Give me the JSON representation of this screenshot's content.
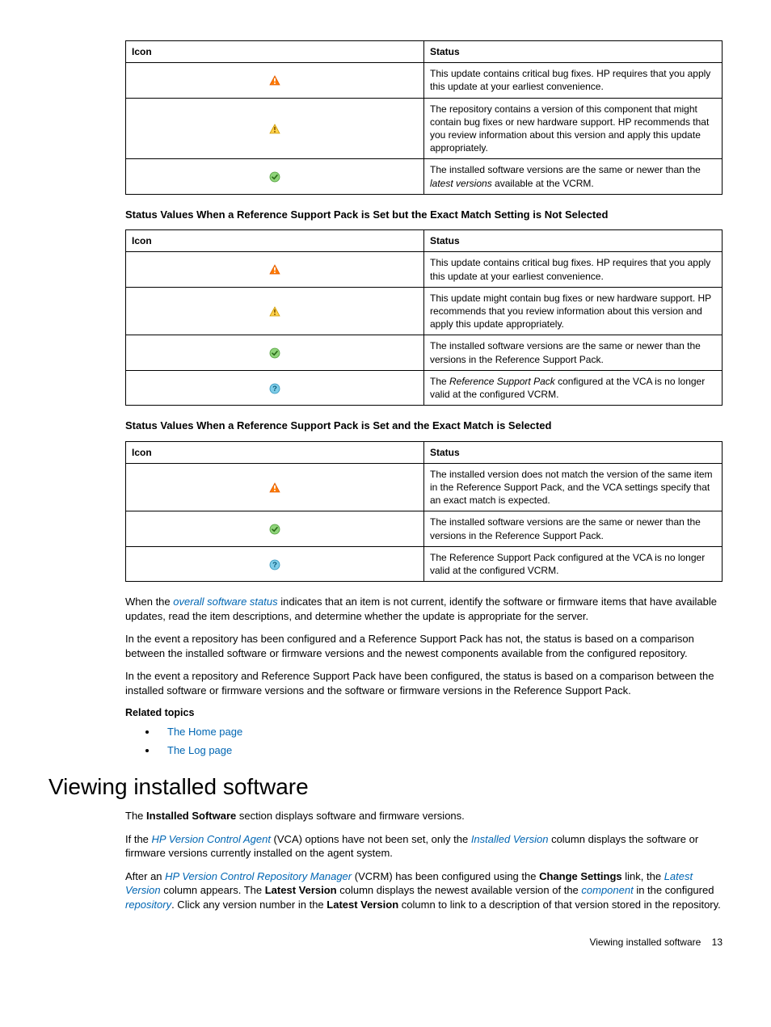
{
  "table1": {
    "headers": [
      "Icon",
      "Status"
    ],
    "rows": [
      {
        "icon": "critical",
        "status_pre": "This update contains critical bug fixes. HP requires that you apply this update at your earliest convenience."
      },
      {
        "icon": "warning",
        "status_pre": "The repository contains a version of this component that might contain bug fixes or new hardware support. HP recommends that you review information about this version and apply this update appropriately."
      },
      {
        "icon": "ok",
        "status_pre": "The installed software versions are the same or newer than the ",
        "status_em": "latest versions",
        "status_post": " available at the VCRM."
      }
    ]
  },
  "heading2": "Status Values When a Reference Support Pack is Set but the Exact Match Setting is Not Selected",
  "table2": {
    "headers": [
      "Icon",
      "Status"
    ],
    "rows": [
      {
        "icon": "critical",
        "status_pre": "This update contains critical bug fixes. HP requires that you apply this update at your earliest convenience."
      },
      {
        "icon": "warning",
        "status_pre": "This update might contain bug fixes or new hardware support. HP recommends that you review information about this version and apply this update appropriately."
      },
      {
        "icon": "ok",
        "status_pre": "The installed software versions are the same or newer than the versions in the Reference Support Pack."
      },
      {
        "icon": "question",
        "status_pre": "The ",
        "status_em": "Reference Support Pack",
        "status_post": " configured at the VCA is no longer valid at the configured VCRM."
      }
    ]
  },
  "heading3": "Status Values When a Reference Support Pack is Set and the Exact Match is Selected",
  "table3": {
    "headers": [
      "Icon",
      "Status"
    ],
    "rows": [
      {
        "icon": "critical",
        "status_pre": "The installed version does not match the version of the same item in the Reference Support Pack, and the VCA settings specify that an exact match is expected."
      },
      {
        "icon": "ok",
        "status_pre": "The installed software versions are the same or newer than the versions in the Reference Support Pack."
      },
      {
        "icon": "question",
        "status_pre": "The Reference Support Pack configured at the VCA is no longer valid at the configured VCRM."
      }
    ]
  },
  "para1": {
    "pre": "When the ",
    "em": "overall software status",
    "post": " indicates that an item is not current, identify the software or firmware items that have available updates, read the item descriptions, and determine whether the update is appropriate for the server."
  },
  "para2": "In the event a repository has been configured and a Reference Support Pack has not, the status is based on a comparison between the installed software or firmware versions and the newest components available from the configured repository.",
  "para3": "In the event a repository and Reference Support Pack have been configured, the status is based on a comparison between the installed software or firmware versions and the software or firmware versions in the Reference Support Pack.",
  "related_label": "Related topics",
  "related_items": [
    "The Home page",
    "The Log page"
  ],
  "h1": "Viewing installed software",
  "vis_para1": {
    "pre": "The ",
    "b1": "Installed Software",
    "post": " section displays software and firmware versions."
  },
  "vis_para2": {
    "pre": "If the ",
    "l1": "HP Version Control Agent",
    "mid": " (VCA) options have not been set, only the ",
    "l2": "Installed Version",
    "post": " column displays the software or firmware versions currently installed on the agent system."
  },
  "vis_para3": {
    "pre": "After an ",
    "l1": "HP Version Control Repository Manager",
    "t1": " (VCRM) has been configured using the ",
    "b1": "Change Settings",
    "t2": " link, the ",
    "l2": "Latest Version",
    "t3": " column appears. The ",
    "b2": "Latest Version",
    "t4": " column displays the newest available version of the ",
    "l3": "component",
    "t5": " in the configured ",
    "l4": "repository",
    "t6": ". Click any version number in the ",
    "b3": "Latest Version",
    "t7": " column to link to a description of that version stored in the repository."
  },
  "footer": {
    "label": "Viewing installed software",
    "page": "13"
  }
}
